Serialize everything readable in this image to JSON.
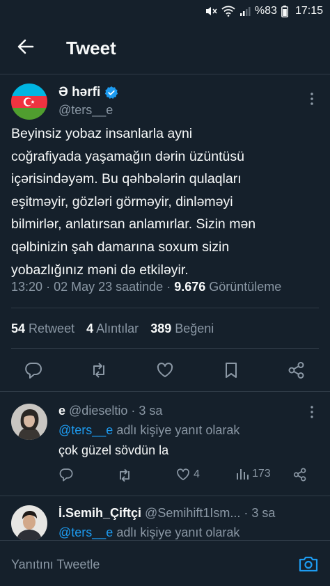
{
  "status_bar": {
    "battery": "%83",
    "time": "17:15"
  },
  "header": {
    "title": "Tweet"
  },
  "tweet": {
    "author_name": "Ə hərfi",
    "author_handle": "@ters__e",
    "text_lines": [
      "Beyinsiz yobaz insanlarla ayni",
      "coğrafiyada yaşamağın dərin üzüntüsü",
      "içərisindəyəm. Bu qəhbələrin qulaqları",
      "eşitməyir, gözləri görməyir, dinləməyi",
      "bilmirlər, anlatırsan anlamırlar. Sizin mən",
      "qəlbinizin şah damarına soxum sizin",
      "yobazlığınız məni də etkiləyir."
    ],
    "time": "13:20",
    "date": "02 May 23 saatinde",
    "views_count": "9.676",
    "views_label": "Görüntüleme",
    "retweets_count": "54",
    "retweets_label": "Retweet",
    "quotes_count": "4",
    "quotes_label": "Alıntılar",
    "likes_count": "389",
    "likes_label": "Beğeni"
  },
  "replies": [
    {
      "name": "e",
      "handle": "@dieseltio",
      "time": "3 sa",
      "reply_to_handle": "@ters__e",
      "reply_to_suffix": "adlı kişiye yanıt olarak",
      "text": "çok güzel sövdün la",
      "likes": "4",
      "views": "173"
    },
    {
      "name": "İ.Semih_Çiftçi",
      "handle": "@Semihift1Ism...",
      "time": "3 sa",
      "reply_to_handle": "@ters__e",
      "reply_to_suffix": "adlı kişiye yanıt olarak"
    }
  ],
  "composer": {
    "placeholder": "Yanıtını Tweetle"
  },
  "colors": {
    "background": "#15202b",
    "accent": "#1d9bf0",
    "muted": "#8b98a5",
    "divider": "#2f3b47"
  },
  "icons": [
    "mute-icon",
    "wifi-icon",
    "signal-icon",
    "battery-icon",
    "back-arrow-icon",
    "verified-badge-icon",
    "more-icon",
    "reply-icon",
    "retweet-icon",
    "like-icon",
    "bookmark-icon",
    "share-icon",
    "views-icon",
    "camera-icon"
  ]
}
